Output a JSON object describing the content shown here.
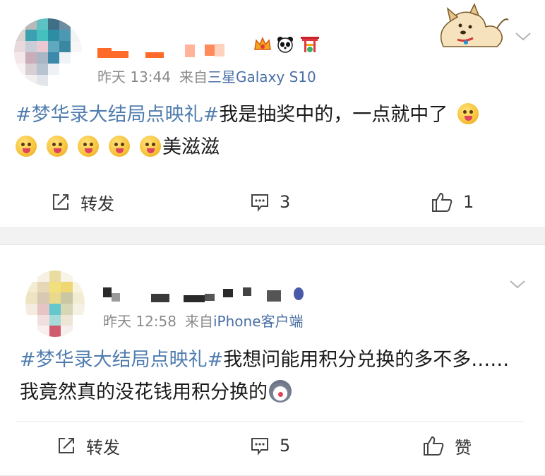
{
  "posts": [
    {
      "time": "昨天 13:44",
      "source_prefix": "来自",
      "source": "三星Galaxy S10",
      "hashtag": "#梦华录大结局点映礼#",
      "text_after_hashtag": "我是抽奖中的，一点就中了",
      "text_end": "美滋滋",
      "emoji_icon": "tongue-out-emoji-icon",
      "emoji_count": 6,
      "actions": {
        "repost": "转发",
        "comments": "3",
        "likes": "1"
      }
    },
    {
      "time": "昨天 12:58",
      "source_prefix": "来自",
      "source": "iPhone客户端",
      "hashtag": "#梦华录大结局点映礼#",
      "text_after_hashtag": "我想问能用积分兑换的多不多……我竟然真的没花钱用积分换的",
      "emoji_icon": "husky-dog-emoji-icon",
      "actions": {
        "repost": "转发",
        "comments": "5",
        "likes": "赞"
      }
    }
  ],
  "colors": {
    "hashtag": "#507daf",
    "meta": "#8a8a8a",
    "background": "#f2f2f2"
  }
}
